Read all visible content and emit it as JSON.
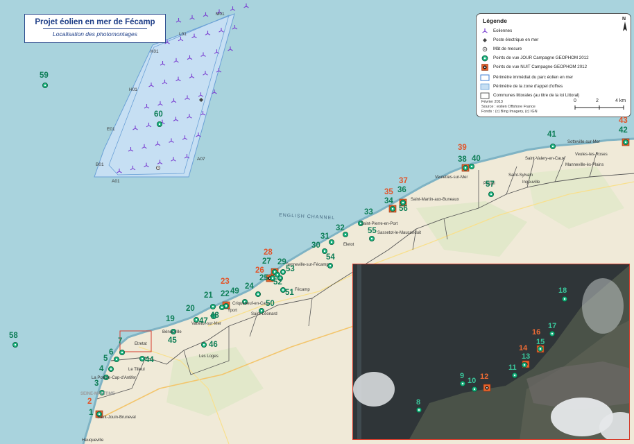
{
  "title": "Projet éolien en mer de Fécamp",
  "subtitle": "Localisation des photomontages",
  "legend": {
    "title": "Légende",
    "items": [
      {
        "label": "Eoliennes"
      },
      {
        "label": "Poste électrique en mer"
      },
      {
        "label": "Mât de mesure"
      },
      {
        "label": "Points de vue JOUR Campagne GEOPHOM 2012"
      },
      {
        "label": "Points de vue NUIT Campagne GEOPHOM 2012"
      },
      {
        "label": "Périmètre immédiat du parc éolien en mer"
      },
      {
        "label": "Périmètre de la zone d'appel d'offres"
      },
      {
        "label": "Communes littorales (au titre de la loi Littoral)"
      }
    ],
    "date": "Février 2013",
    "source": "Source : eolien Offshore France",
    "fond": "Fonds : (c) Bing Imagery, (c) IGN",
    "north": "N",
    "scale": [
      "0",
      "2",
      "4 km"
    ]
  },
  "sea_label": "ENGLISH CHANNEL",
  "grid_labels": [
    "M01",
    "L01",
    "K01",
    "H01",
    "E01",
    "B01",
    "A01",
    "A07"
  ],
  "places": [
    "Sotteville-sur-Mer",
    "Veules-les-Roses",
    "Manneville-ès-Plains",
    "Saint-Valery-en-Caux",
    "Saint-Sylvain",
    "Ingouville",
    "Paluel",
    "Veulettes-sur-Mer",
    "Saint-Martin-aux-Buneaux",
    "Saint-Pierre-en-Port",
    "Sassetot-le-Mauconduit",
    "Eletot",
    "Senneville-sur-Fécamp",
    "Fécamp",
    "Saint-Léonard",
    "Yport",
    "Criquebeuf-en-Caux",
    "Vattetot-sur-Mer",
    "Bénouville",
    "Les Loges",
    "Etretat",
    "Le Tilleul",
    "La Poterie-Cap-d'Antifer",
    "SEINE-MARITIME",
    "Saint-Jouin-Bruneval",
    "Heuqueville"
  ],
  "viewpoints": {
    "day": [
      "1",
      "3",
      "4",
      "5",
      "6",
      "7",
      "19",
      "20",
      "21",
      "22",
      "24",
      "25",
      "27",
      "29",
      "30",
      "31",
      "32",
      "33",
      "34",
      "36",
      "38",
      "40",
      "41",
      "42",
      "44",
      "45",
      "46",
      "47",
      "48",
      "49",
      "50",
      "51",
      "52",
      "53",
      "54",
      "55",
      "56",
      "57",
      "58",
      "59",
      "60"
    ],
    "night": [
      "2",
      "23",
      "26",
      "28",
      "35",
      "37",
      "39",
      "43"
    ]
  },
  "inset": {
    "day": [
      "8",
      "9",
      "10",
      "11",
      "13",
      "15",
      "17",
      "18"
    ],
    "night": [
      "12",
      "14",
      "16"
    ]
  }
}
